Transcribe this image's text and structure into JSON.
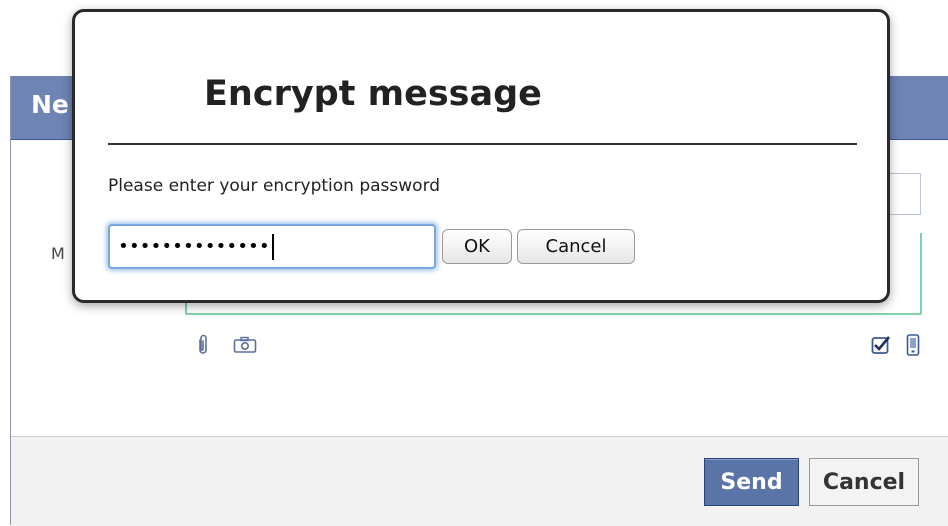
{
  "background_window": {
    "header_title": "Ne",
    "message_label": "M",
    "attach_icon": "paperclip-icon",
    "camera_icon": "camera-icon",
    "checkbox_checked": true,
    "mobile_icon": "mobile-phone-icon",
    "send_label": "Send",
    "cancel_label": "Cancel",
    "colors": {
      "header": "#6d84b4",
      "send_button": "#5b74a8",
      "message_border": "#7fd1a8"
    }
  },
  "dialog": {
    "title": "Encrypt message",
    "prompt": "Please enter your encryption password",
    "password_value": "••••••••••••••",
    "ok_label": "OK",
    "cancel_label": "Cancel"
  }
}
